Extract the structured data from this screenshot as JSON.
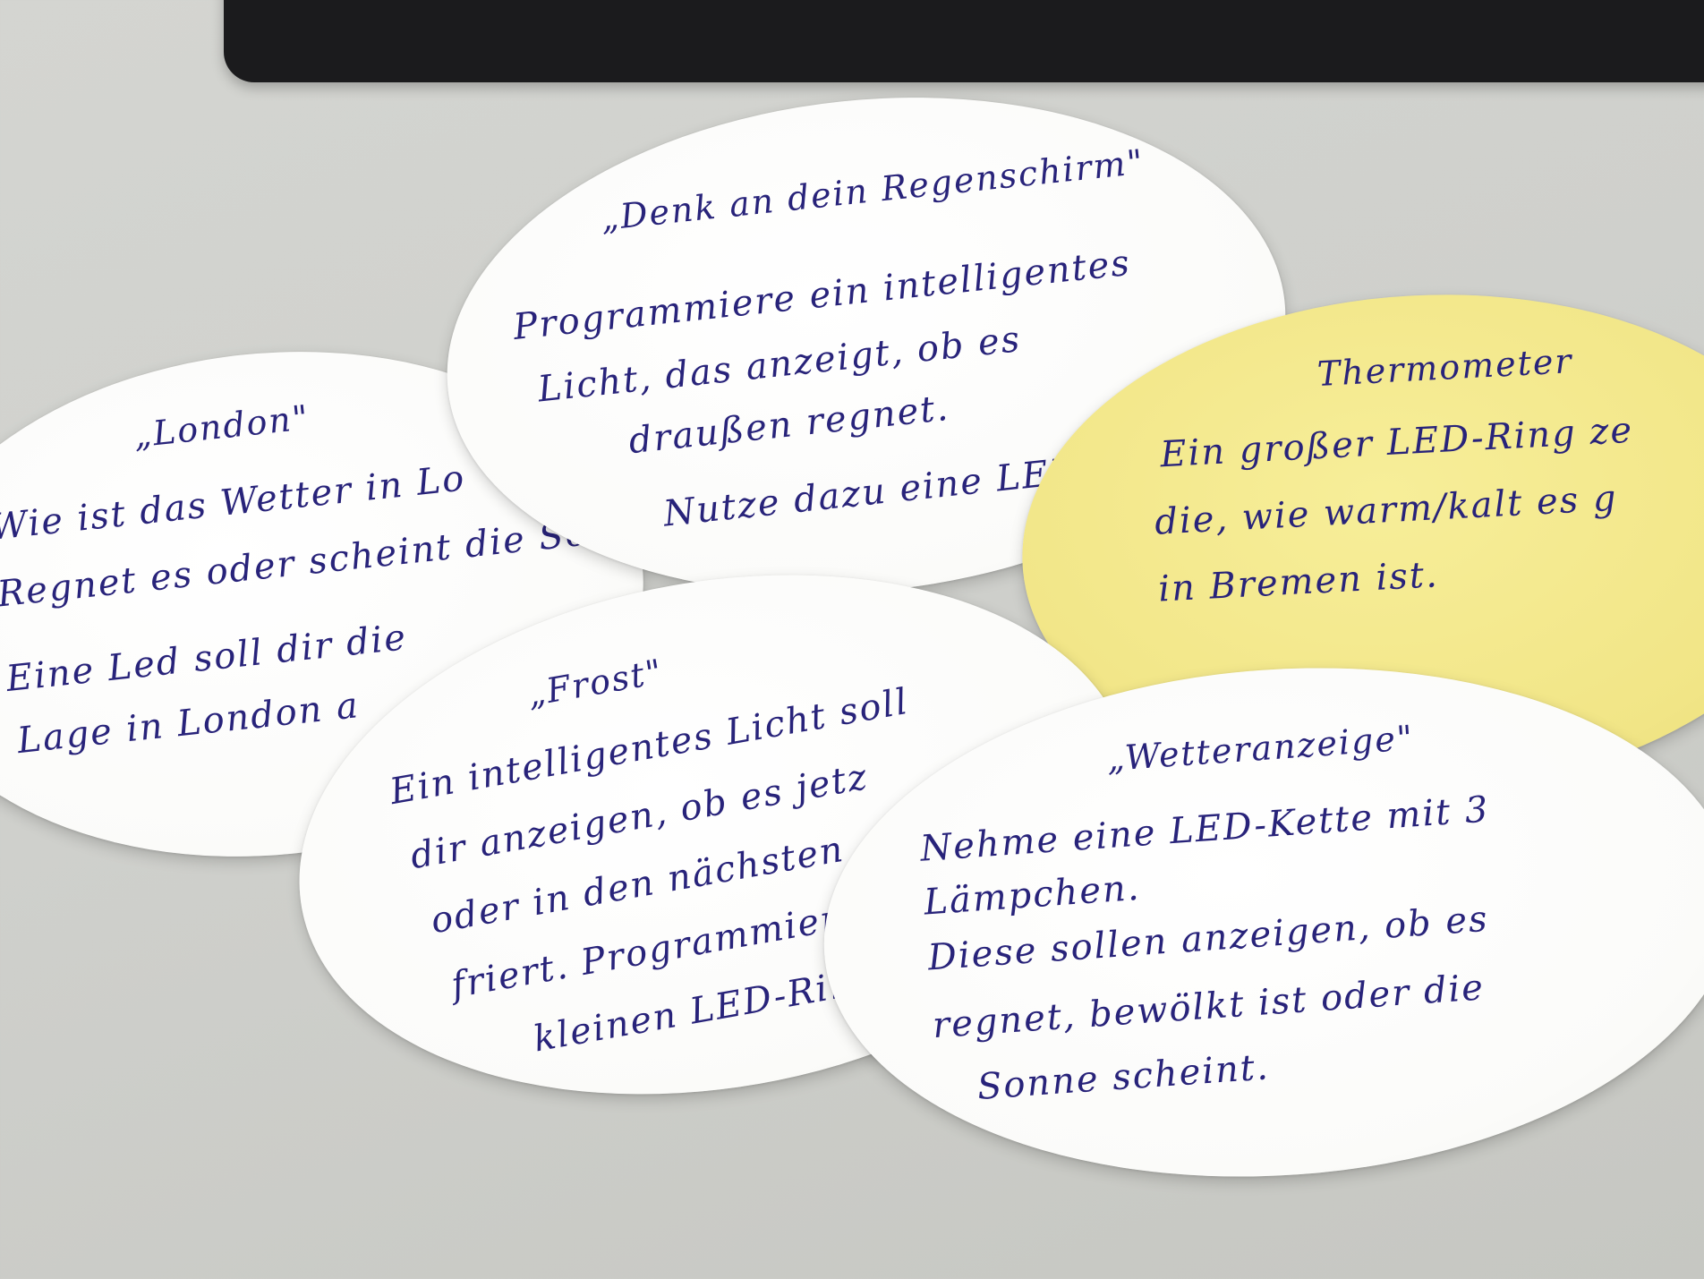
{
  "cards": {
    "london": {
      "title": "„London\"",
      "lines": [
        "Wie ist das Wetter in Lo",
        "Regnet es oder scheint die Sonn",
        "Eine Led soll dir die",
        "Lage in London a"
      ]
    },
    "regenschirm": {
      "title": "„Denk an dein Regenschirm\"",
      "lines": [
        "Programmiere ein intelligentes",
        "Licht, das anzeigt, ob es",
        "draußen regnet.",
        "Nutze dazu eine LED-"
      ]
    },
    "thermometer": {
      "title": "Thermometer",
      "lines": [
        "Ein großer LED-Ring ze",
        "die, wie warm/kalt es g",
        "in Bremen ist."
      ]
    },
    "frost": {
      "title": "„Frost\"",
      "lines": [
        "Ein intelligentes Licht soll",
        "dir anzeigen, ob es jetz",
        "oder in den nächsten",
        "friert. Programmier",
        "kleinen LED-Ring"
      ]
    },
    "wetteranzeige": {
      "title": "„Wetteranzeige\"",
      "lines": [
        "Nehme eine LED-Kette mit 3",
        "Lämpchen.",
        "Diese sollen anzeigen, ob es",
        "regnet, bewölkt ist oder die",
        "Sonne scheint."
      ]
    }
  },
  "colors": {
    "ink": "#28237a",
    "paper_white": "#fbfbf9",
    "paper_yellow": "#f1e586",
    "desk": "#cfd0cc",
    "monitor": "#1b1b1d"
  }
}
